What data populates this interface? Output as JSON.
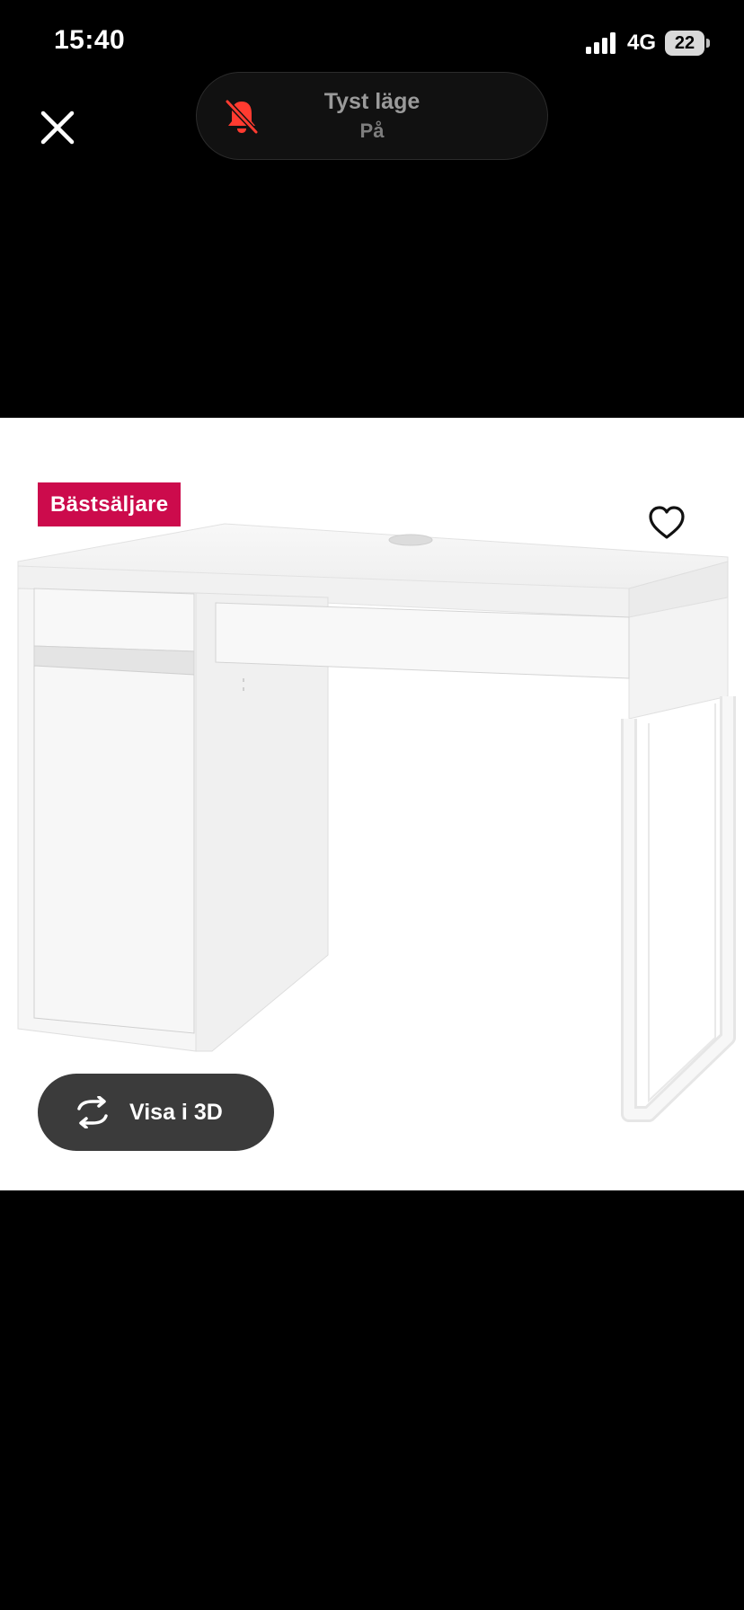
{
  "status_bar": {
    "time": "15:40",
    "network": "4G",
    "battery": "22"
  },
  "toast": {
    "title": "Tyst läge",
    "subtitle": "På",
    "icon": "bell-slash-icon",
    "icon_color": "#ff3b30"
  },
  "product_image": {
    "badge": "Bästsäljare",
    "badge_color": "#cc0b4c",
    "view_3d_label": "Visa i 3D",
    "view_3d_icon": "rotate-3d-icon",
    "favorite_icon": "heart-icon",
    "close_icon": "close-icon"
  }
}
